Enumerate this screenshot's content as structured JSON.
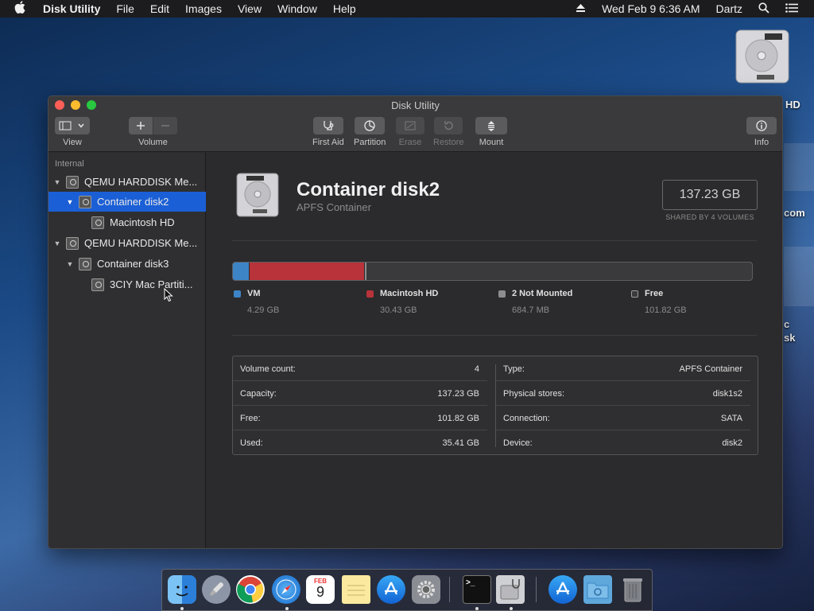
{
  "menubar": {
    "app_name": "Disk Utility",
    "items": [
      "File",
      "Edit",
      "Images",
      "View",
      "Window",
      "Help"
    ],
    "clock": "Wed Feb 9  6:36 AM",
    "user": "Dartz"
  },
  "desktop": {
    "label_hd": "HD",
    "label_com": "com",
    "label_c": "c",
    "label_sk": "sk"
  },
  "window": {
    "title": "Disk Utility",
    "toolbar": {
      "view": "View",
      "volume": "Volume",
      "first_aid": "First Aid",
      "partition": "Partition",
      "erase": "Erase",
      "restore": "Restore",
      "mount": "Mount",
      "info": "Info"
    }
  },
  "sidebar": {
    "header": "Internal",
    "items": [
      {
        "label": "QEMU HARDDISK Me..."
      },
      {
        "label": "Container disk2"
      },
      {
        "label": "Macintosh HD"
      },
      {
        "label": "QEMU HARDDISK Me..."
      },
      {
        "label": "Container disk3"
      },
      {
        "label": "3CIY Mac Partiti..."
      }
    ]
  },
  "detail": {
    "title": "Container disk2",
    "subtitle": "APFS Container",
    "size": "137.23 GB",
    "shared": "SHARED BY 4 VOLUMES",
    "usage": {
      "total_gb": 137.23,
      "segments": [
        {
          "name": "VM",
          "value": "4.29 GB",
          "gb": 4.29,
          "color": "#3d84c6"
        },
        {
          "name": "Macintosh HD",
          "value": "30.43 GB",
          "gb": 30.43,
          "color": "#b8333a"
        },
        {
          "name": "2 Not Mounted",
          "value": "684.7 MB",
          "gb": 0.68,
          "color": "#8e8e8e"
        },
        {
          "name": "Free",
          "value": "101.82 GB",
          "gb": 101.82,
          "color": "#3a3a3c"
        }
      ]
    },
    "info_left": [
      {
        "key": "Volume count:",
        "value": "4"
      },
      {
        "key": "Capacity:",
        "value": "137.23 GB"
      },
      {
        "key": "Free:",
        "value": "101.82 GB"
      },
      {
        "key": "Used:",
        "value": "35.41 GB"
      }
    ],
    "info_right": [
      {
        "key": "Type:",
        "value": "APFS Container"
      },
      {
        "key": "Physical stores:",
        "value": "disk1s2"
      },
      {
        "key": "Connection:",
        "value": "SATA"
      },
      {
        "key": "Device:",
        "value": "disk2"
      }
    ]
  },
  "dock": {
    "calendar_month": "FEB",
    "calendar_day": "9",
    "terminal_prompt": ">_"
  },
  "colors": {
    "accent": "#1b5fd6",
    "vm": "#3d84c6",
    "macintosh_hd": "#b8333a"
  }
}
